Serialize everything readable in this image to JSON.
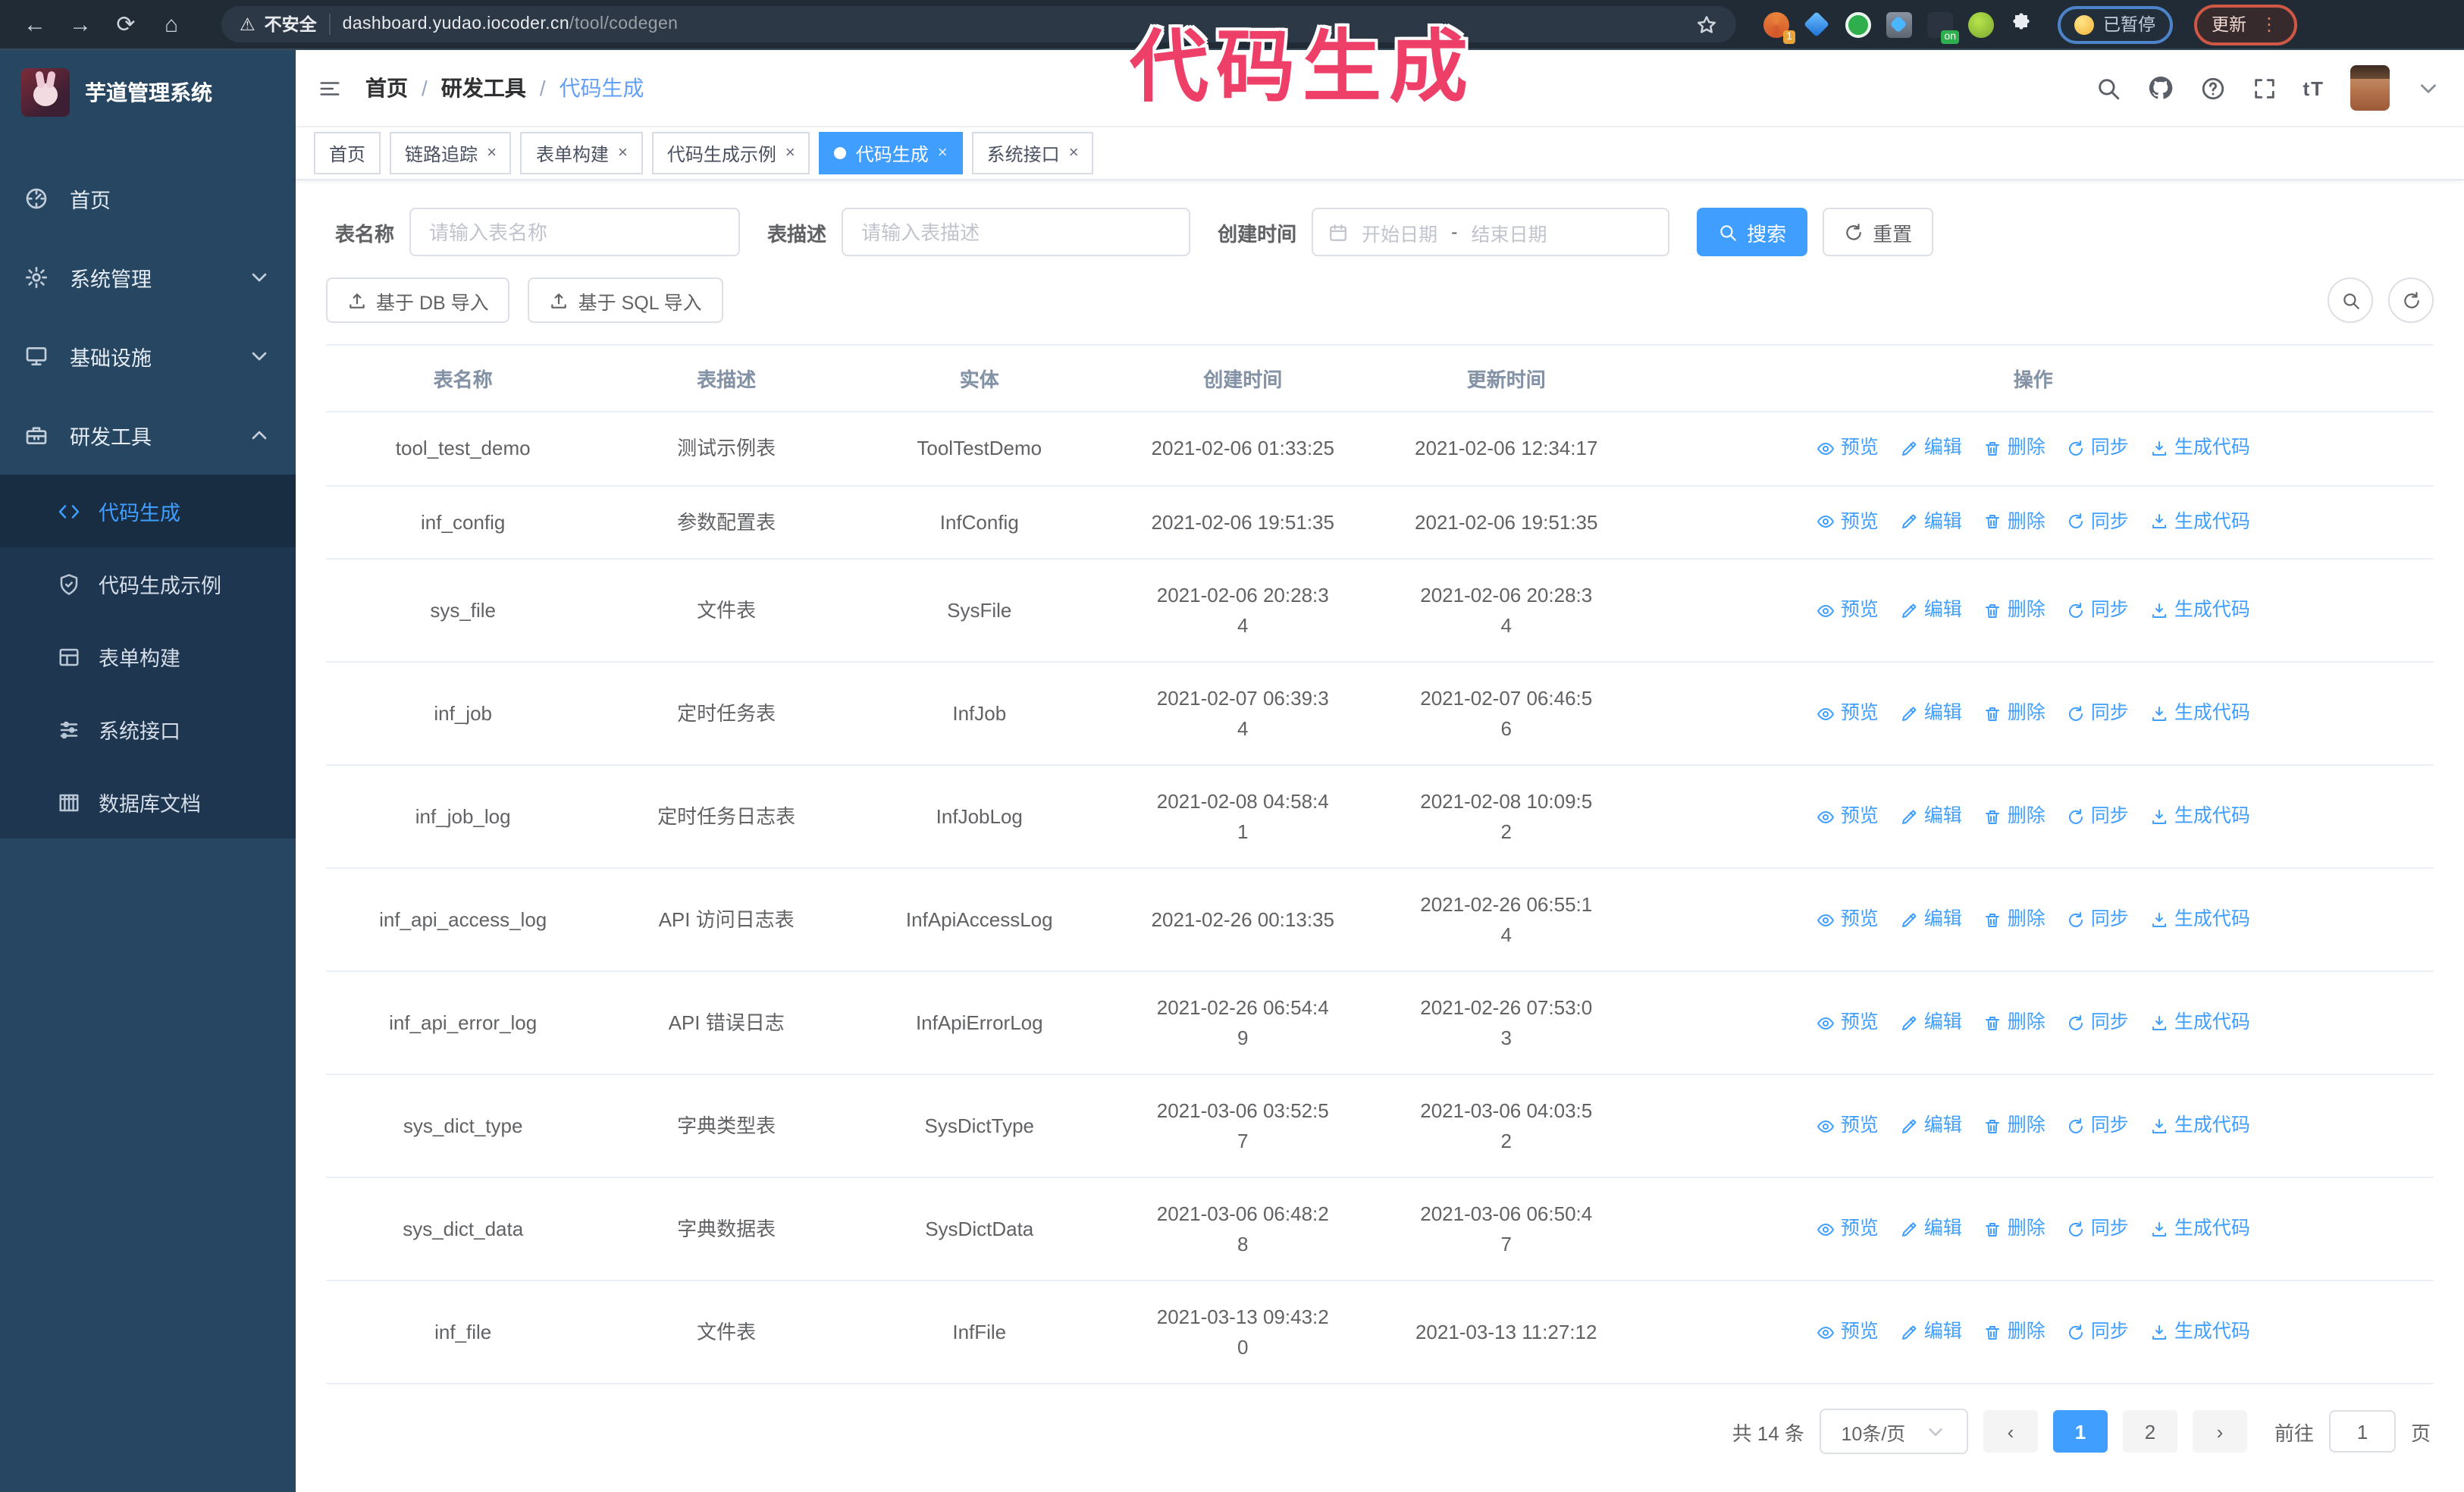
{
  "colors": {
    "accent": "#409eff",
    "annotation": "#ee3f68",
    "sidebar": "#274662",
    "submenu": "#1e3650",
    "toolbar_dark": "#212b36"
  },
  "icons": {
    "back": "←",
    "forward": "→",
    "reload": "⟳",
    "home": "⌂",
    "warning": "⚠",
    "menu_dots": "⋮",
    "prev": "‹",
    "next": "›",
    "font_size": "tT",
    "range_sep": "-"
  },
  "browser": {
    "security_label": "不安全",
    "url_host": "dashboard.yudao.iocoder.cn",
    "url_path": "/tool/codegen",
    "ext_badge_count": "1",
    "ext_badge_on": "on",
    "paused_badge": "已暂停",
    "update_button": "更新"
  },
  "annotation": {
    "text": "代码生成"
  },
  "sidebar": {
    "title": "芋道管理系统",
    "menu": [
      {
        "label": "首页",
        "icon": "dashboard-icon",
        "chevron": null
      },
      {
        "label": "系统管理",
        "icon": "gear-icon",
        "chevron": "down"
      },
      {
        "label": "基础设施",
        "icon": "monitor-icon",
        "chevron": "down"
      },
      {
        "label": "研发工具",
        "icon": "toolbox-icon",
        "chevron": "up"
      }
    ],
    "submenu": [
      {
        "label": "代码生成",
        "icon": "code-icon",
        "active": true
      },
      {
        "label": "代码生成示例",
        "icon": "shield-check-icon",
        "active": false
      },
      {
        "label": "表单构建",
        "icon": "form-icon",
        "active": false
      },
      {
        "label": "系统接口",
        "icon": "sliders-icon",
        "active": false
      },
      {
        "label": "数据库文档",
        "icon": "database-icon",
        "active": false
      }
    ]
  },
  "header": {
    "breadcrumb": [
      "首页",
      "研发工具",
      "代码生成"
    ]
  },
  "tabs": [
    {
      "label": "首页",
      "closable": false,
      "active": false
    },
    {
      "label": "链路追踪",
      "closable": true,
      "active": false
    },
    {
      "label": "表单构建",
      "closable": true,
      "active": false
    },
    {
      "label": "代码生成示例",
      "closable": true,
      "active": false
    },
    {
      "label": "代码生成",
      "closable": true,
      "active": true
    },
    {
      "label": "系统接口",
      "closable": true,
      "active": false
    }
  ],
  "filters": {
    "name_label": "表名称",
    "name_placeholder": "请输入表名称",
    "desc_label": "表描述",
    "desc_placeholder": "请输入表描述",
    "time_label": "创建时间",
    "start_placeholder": "开始日期",
    "separator": "-",
    "end_placeholder": "结束日期",
    "search": "搜索",
    "reset": "重置"
  },
  "toolbar": {
    "db_import": "基于 DB 导入",
    "sql_import": "基于 SQL 导入"
  },
  "table": {
    "columns": [
      "表名称",
      "表描述",
      "实体",
      "创建时间",
      "更新时间",
      "操作"
    ],
    "rows": [
      {
        "name": "tool_test_demo",
        "desc": "测试示例表",
        "entity": "ToolTestDemo",
        "created": "2021-02-06 01:33:25",
        "updated": "2021-02-06 12:34:17"
      },
      {
        "name": "inf_config",
        "desc": "参数配置表",
        "entity": "InfConfig",
        "created": "2021-02-06 19:51:35",
        "updated": "2021-02-06 19:51:35"
      },
      {
        "name": "sys_file",
        "desc": "文件表",
        "entity": "SysFile",
        "created": "2021-02-06 20:28:3\n4",
        "updated": "2021-02-06 20:28:3\n4"
      },
      {
        "name": "inf_job",
        "desc": "定时任务表",
        "entity": "InfJob",
        "created": "2021-02-07 06:39:3\n4",
        "updated": "2021-02-07 06:46:5\n6"
      },
      {
        "name": "inf_job_log",
        "desc": "定时任务日志表",
        "entity": "InfJobLog",
        "created": "2021-02-08 04:58:4\n1",
        "updated": "2021-02-08 10:09:5\n2"
      },
      {
        "name": "inf_api_access_log",
        "desc": "API 访问日志表",
        "entity": "InfApiAccessLog",
        "created": "2021-02-26 00:13:35",
        "updated": "2021-02-26 06:55:1\n4"
      },
      {
        "name": "inf_api_error_log",
        "desc": "API 错误日志",
        "entity": "InfApiErrorLog",
        "created": "2021-02-26 06:54:4\n9",
        "updated": "2021-02-26 07:53:0\n3"
      },
      {
        "name": "sys_dict_type",
        "desc": "字典类型表",
        "entity": "SysDictType",
        "created": "2021-03-06 03:52:5\n7",
        "updated": "2021-03-06 04:03:5\n2"
      },
      {
        "name": "sys_dict_data",
        "desc": "字典数据表",
        "entity": "SysDictData",
        "created": "2021-03-06 06:48:2\n8",
        "updated": "2021-03-06 06:50:4\n7"
      },
      {
        "name": "inf_file",
        "desc": "文件表",
        "entity": "InfFile",
        "created": "2021-03-13 09:43:2\n0",
        "updated": "2021-03-13 11:27:12"
      }
    ],
    "actions": [
      {
        "label": "预览",
        "icon": "eye"
      },
      {
        "label": "编辑",
        "icon": "edit"
      },
      {
        "label": "删除",
        "icon": "delete"
      },
      {
        "label": "同步",
        "icon": "sync"
      },
      {
        "label": "生成代码",
        "icon": "download"
      }
    ]
  },
  "pagination": {
    "total": "共 14 条",
    "page_size": "10条/页",
    "pages": [
      {
        "label": "1",
        "active": true
      },
      {
        "label": "2",
        "active": false
      }
    ],
    "goto_label": "前往",
    "goto_value": "1",
    "unit": "页"
  }
}
